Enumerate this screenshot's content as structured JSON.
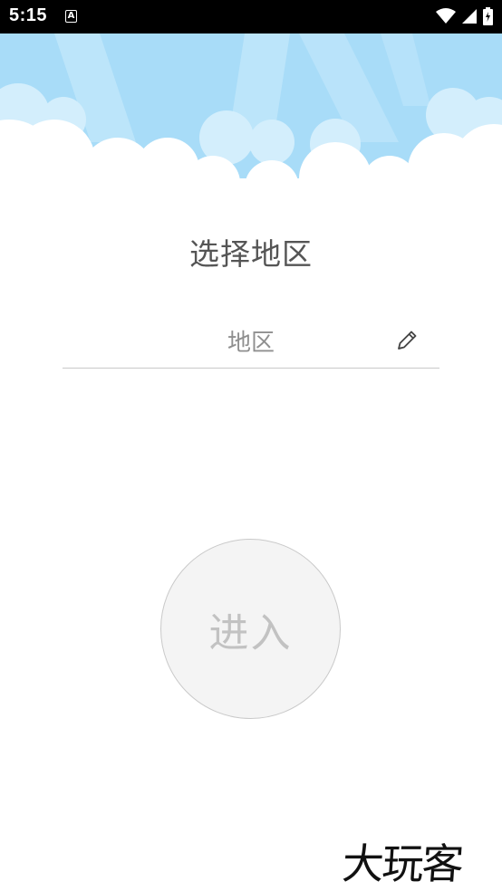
{
  "status_bar": {
    "time": "5:15",
    "notification": "A",
    "icons": [
      "wifi-icon",
      "signal-icon",
      "battery-icon"
    ]
  },
  "page": {
    "title": "选择地区"
  },
  "region": {
    "value": "地区",
    "icon": "pencil-icon"
  },
  "enter_button": {
    "label": "进入"
  },
  "watermark": {
    "text": "大玩客"
  },
  "colors": {
    "sky": "#a8dcf8",
    "cloud": "#ffffff",
    "title_text": "#555555",
    "field_text": "#8f8f8f",
    "button_bg": "#f4f4f4",
    "button_text": "#c2c2c2"
  }
}
